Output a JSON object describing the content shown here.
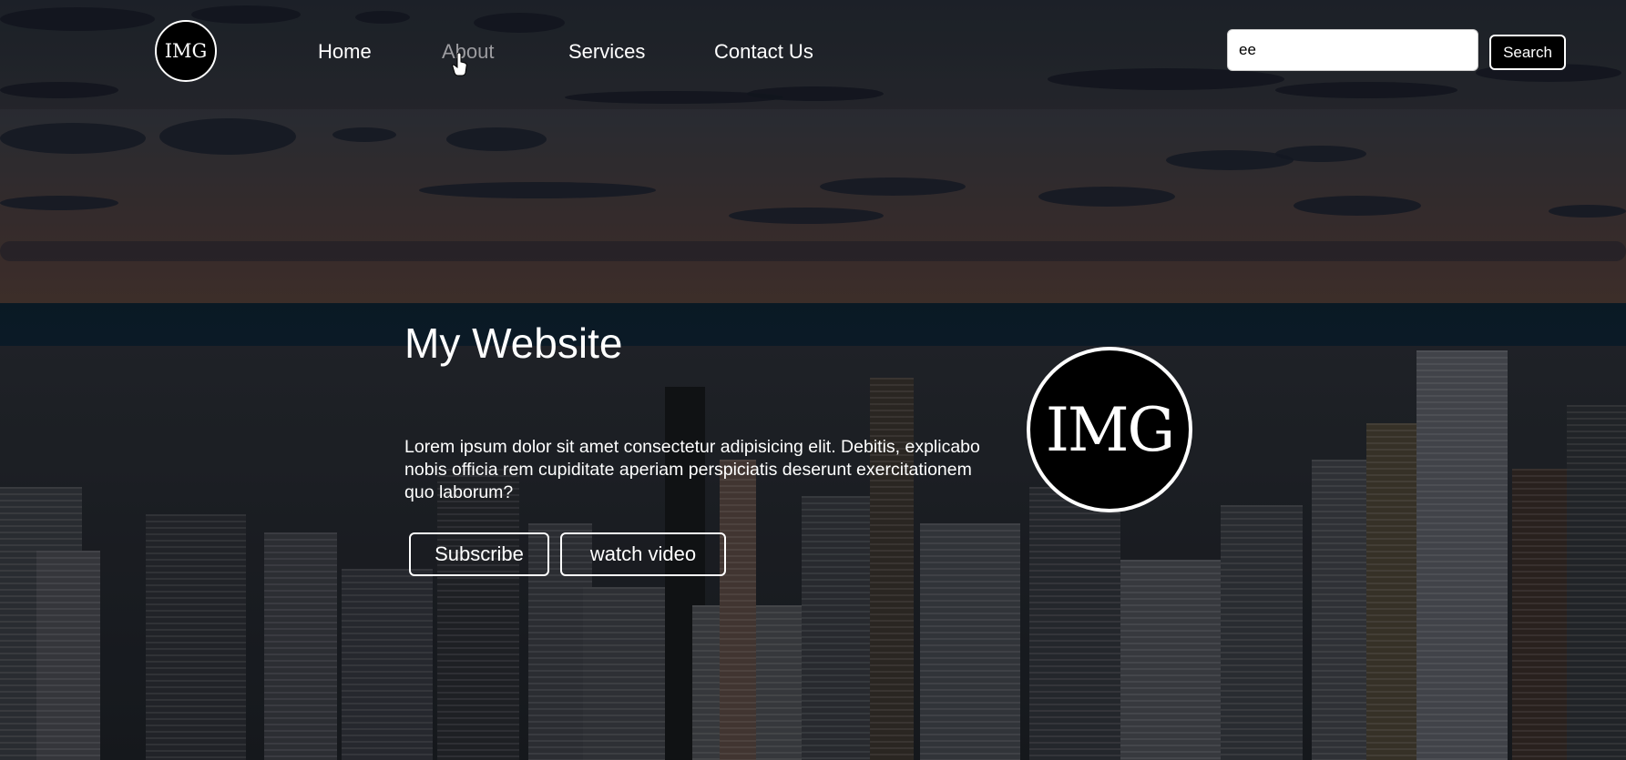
{
  "brand": {
    "logo_text": "IMG"
  },
  "nav": {
    "items": [
      {
        "label": "Home"
      },
      {
        "label": "About"
      },
      {
        "label": "Services"
      },
      {
        "label": "Contact Us"
      }
    ]
  },
  "search": {
    "value": "ee",
    "button_label": "Search"
  },
  "hero": {
    "title": "My Website",
    "text": "Lorem ipsum dolor sit amet consectetur adipisicing elit. Debitis, explicabo nobis officia rem cupiditate aperiam perspiciatis deserunt exercitationem quo laborum?",
    "subscribe_label": "Subscribe",
    "watch_label": "watch video",
    "logo_text": "IMG"
  },
  "colors": {
    "accent": "#000000",
    "text": "#ffffff",
    "nav_hover": "#9c9ca0"
  }
}
